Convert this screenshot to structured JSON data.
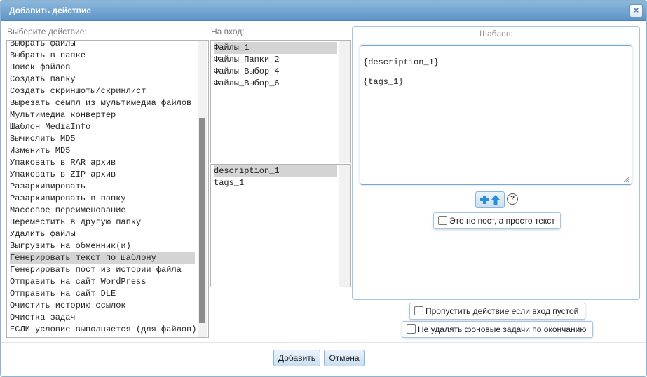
{
  "dialog": {
    "title": "Добавить действие",
    "close_label": "×"
  },
  "actions": {
    "label": "Выберите действие:",
    "items": [
      "Выбрать файлы",
      "Выбрать в папке",
      "Поиск файлов",
      "Создать папку",
      "Создать скриншоты/скринлист",
      "Вырезать семпл из мультимедиа файлов",
      "Мультимедиа конвертер",
      "Шаблон MediaInfo",
      "Вычислить MD5",
      "Изменить MD5",
      "Упаковать в RAR архив",
      "Упаковать в ZIP архив",
      "Разархивировать",
      "Разархивировать в папку",
      "Массовое переименование",
      "Переместить в другую папку",
      "Удалить файлы",
      "Выгрузить на обменник(и)",
      "Генерировать текст по шаблону",
      "Генерировать пост из истории файла",
      "Отправить на сайт WordPress",
      "Отправить на сайт DLE",
      "Очистить историю ссылок",
      "Очистка задач",
      "ЕСЛИ условие выполняется (для файлов)"
    ],
    "selected": "Генерировать текст по шаблону"
  },
  "inputs": {
    "label": "На вход:",
    "items": [
      "Файлы_1",
      "Файлы_Папки_2",
      "Файлы_Выбор_4",
      "Файлы_Выбор_6"
    ],
    "selected": "Файлы_1"
  },
  "variables": {
    "items": [
      "description_1",
      "tags_1"
    ],
    "selected": "description_1"
  },
  "template": {
    "label": "Шаблон:",
    "lines": [
      "{description_1}",
      "",
      "{tags_1}"
    ],
    "help_label": "?",
    "not_post_label": "Это не пост, а просто текст"
  },
  "options": {
    "skip_empty_label": "Пропустить действие если вход пустой",
    "keep_tasks_label": "Не удалять фоновые задачи по окончанию"
  },
  "footer": {
    "add_label": "Добавить",
    "cancel_label": "Отмена"
  },
  "colors": {
    "title_bar": "#5d94c6",
    "selection": "#d4d4d4",
    "button": "#c9def1"
  }
}
